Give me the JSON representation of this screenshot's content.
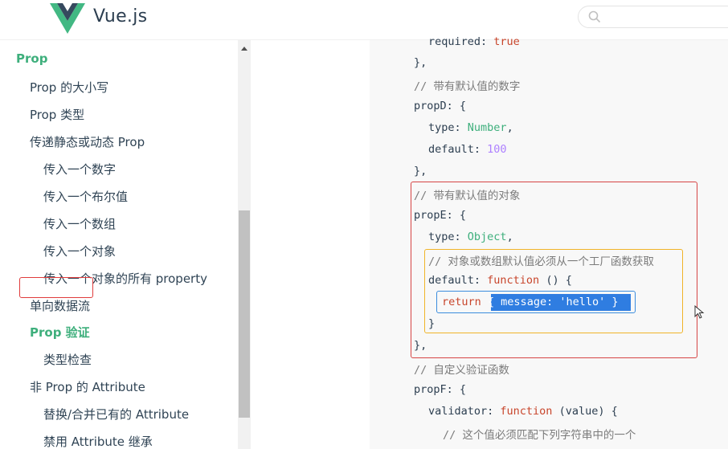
{
  "header": {
    "brand": "Vue.js",
    "colors": {
      "brand_green": "#42b883",
      "brand_dark": "#35495e"
    }
  },
  "sidebar": {
    "items": [
      {
        "label": "Prop",
        "level": 0,
        "active": true
      },
      {
        "label": "Prop 的大小写",
        "level": 1
      },
      {
        "label": "Prop 类型",
        "level": 1
      },
      {
        "label": "传递静态或动态 Prop",
        "level": 1
      },
      {
        "label": "传入一个数字",
        "level": 2
      },
      {
        "label": "传入一个布尔值",
        "level": 2
      },
      {
        "label": "传入一个数组",
        "level": 2
      },
      {
        "label": "传入一个对象",
        "level": 2
      },
      {
        "label": "传入一个对象的所有 property",
        "level": 2
      },
      {
        "label": "单向数据流",
        "level": 1
      },
      {
        "label": "Prop 验证",
        "level": 1,
        "active": true,
        "highlighted": true
      },
      {
        "label": "类型检查",
        "level": 2
      },
      {
        "label": "非 Prop 的 Attribute",
        "level": 1
      },
      {
        "label": "替换/合并已有的 Attribute",
        "level": 2
      },
      {
        "label": "禁用 Attribute 继承",
        "level": 2
      }
    ]
  },
  "code": {
    "l0_key": "required: ",
    "l0_val": "true",
    "l1": "},",
    "l2": "// 带有默认值的数字",
    "l3": "propD: {",
    "l4_key": "type: ",
    "l4_val": "Number",
    "l4_end": ",",
    "l5_key": "default: ",
    "l5_val": "100",
    "l6": "},",
    "l7": "// 带有默认值的对象",
    "l8": "propE: {",
    "l9_key": "type: ",
    "l9_val": "Object",
    "l9_end": ",",
    "l10": "// 对象或数组默认值必须从一个工厂函数获取",
    "l11_key": "default: ",
    "l11_fn": "function",
    "l11_end": " () {",
    "l12_ret": "return",
    "l12_sel": "{ message: 'hello' }",
    "l13": "}",
    "l14": "},",
    "l15": "// 自定义验证函数",
    "l16": "propF: {",
    "l17_key": "validator: ",
    "l17_fn": "function",
    "l17_end": " (value) {",
    "l18": "// 这个值必须匹配下列字符串中的一个"
  }
}
